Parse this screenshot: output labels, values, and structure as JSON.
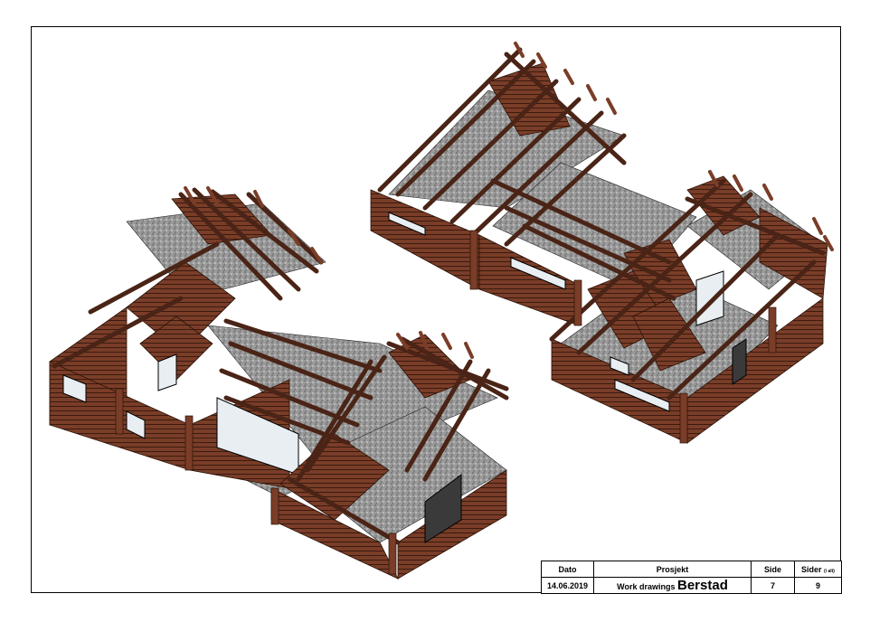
{
  "title_block": {
    "headers": {
      "date": "Dato",
      "project": "Prosjekt",
      "page": "Side",
      "pages": "Sider",
      "pages_note": "(i alt)"
    },
    "values": {
      "date": "14.06.2019",
      "project_prefix": "Work drawings",
      "project_name": "Berstad",
      "page": "7",
      "pages": "9"
    }
  },
  "colors": {
    "log": "#7a3d28",
    "log_dark": "#4a2416",
    "log_line": "#2a1208",
    "gravel": "#8c8c8c",
    "window": "#e8eef2",
    "frame": "#000000"
  },
  "drawing": {
    "views": [
      "left-isometric-view",
      "right-isometric-view"
    ]
  }
}
